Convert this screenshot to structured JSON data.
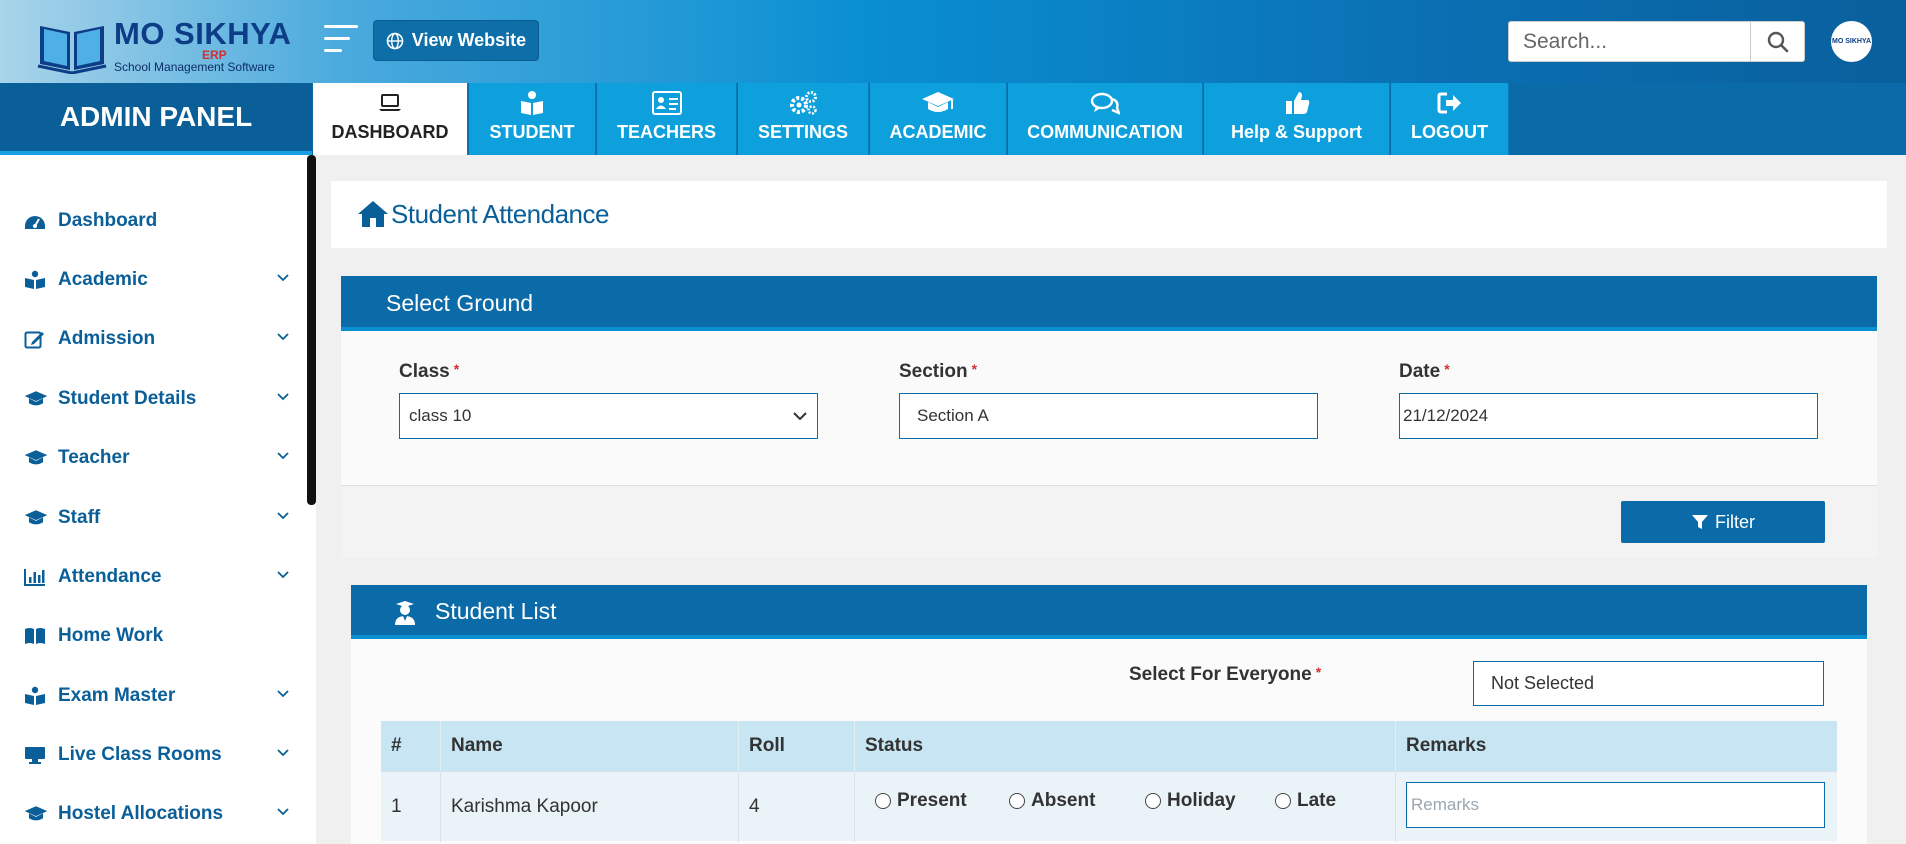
{
  "brand": {
    "name": "MO SIKHYA",
    "erp": "ERP",
    "tagline": "School Management Software"
  },
  "header": {
    "view_website": "View Website",
    "search_placeholder": "Search...",
    "avatar_text": "MO SIKHYA"
  },
  "nav": {
    "panel_title": "ADMIN PANEL",
    "tabs": [
      {
        "label": "DASHBOARD",
        "icon": "laptop-icon",
        "active": true
      },
      {
        "label": "STUDENT",
        "icon": "book-reader-icon"
      },
      {
        "label": "TEACHERS",
        "icon": "id-card-icon"
      },
      {
        "label": "SETTINGS",
        "icon": "gears-icon"
      },
      {
        "label": "ACADEMIC",
        "icon": "graduation-cap-icon"
      },
      {
        "label": "COMMUNICATION",
        "icon": "chat-icon"
      },
      {
        "label": "Help & Support",
        "icon": "thumbs-up-icon"
      },
      {
        "label": "LOGOUT",
        "icon": "sign-out-icon"
      }
    ]
  },
  "sidebar": {
    "items": [
      {
        "label": "Dashboard",
        "icon": "dashboard-icon",
        "expandable": false
      },
      {
        "label": "Academic",
        "icon": "reader-icon",
        "expandable": true
      },
      {
        "label": "Admission",
        "icon": "edit-icon",
        "expandable": true
      },
      {
        "label": "Student Details",
        "icon": "graduation-cap-icon",
        "expandable": true
      },
      {
        "label": "Teacher",
        "icon": "graduation-cap-icon",
        "expandable": true
      },
      {
        "label": "Staff",
        "icon": "graduation-cap-icon",
        "expandable": true
      },
      {
        "label": "Attendance",
        "icon": "bar-chart-icon",
        "expandable": true
      },
      {
        "label": "Home Work",
        "icon": "open-book-icon",
        "expandable": false
      },
      {
        "label": "Exam Master",
        "icon": "reader-icon",
        "expandable": true
      },
      {
        "label": "Live Class Rooms",
        "icon": "monitor-icon",
        "expandable": true
      },
      {
        "label": "Hostel Allocations",
        "icon": "graduation-cap-icon",
        "expandable": true
      }
    ]
  },
  "page": {
    "title": "Student Attendance"
  },
  "filter": {
    "heading": "Select Ground",
    "class_label": "Class",
    "class_value": "class 10",
    "section_label": "Section",
    "section_value": "Section A",
    "date_label": "Date",
    "date_value": "21/12/2024",
    "required_mark": "*",
    "button": "Filter"
  },
  "student_list": {
    "heading": "Student List",
    "select_everyone_label": "Select For Everyone",
    "select_everyone_value": "Not Selected",
    "columns": [
      "#",
      "Name",
      "Roll",
      "Status",
      "Remarks"
    ],
    "status_options": [
      "Present",
      "Absent",
      "Holiday",
      "Late"
    ],
    "remarks_placeholder": "Remarks",
    "rows": [
      {
        "index": "1",
        "name": "Karishma Kapoor",
        "roll": "4"
      }
    ]
  },
  "colors": {
    "primary": "#0b6aa8",
    "accent": "#0ea0dc",
    "required": "#d32f2f"
  }
}
